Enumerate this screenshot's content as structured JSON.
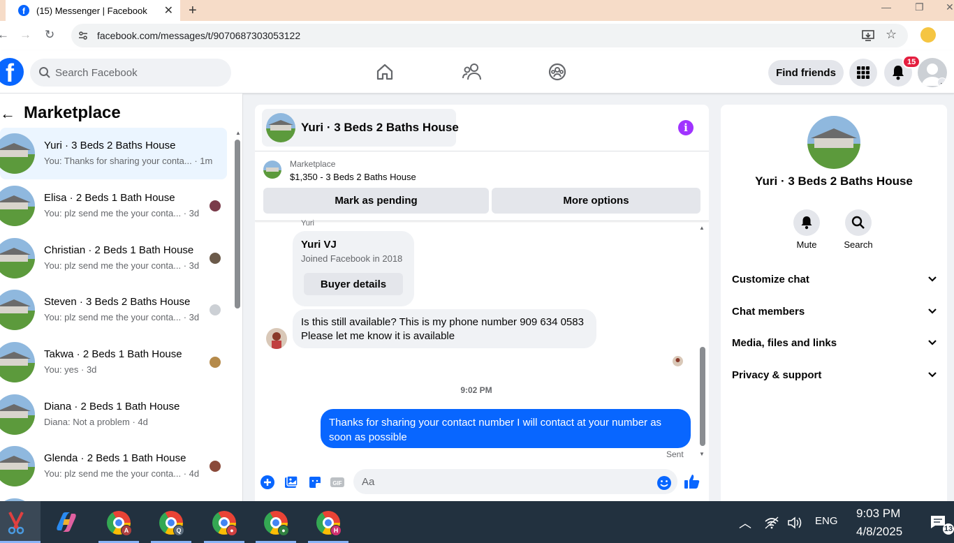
{
  "browser": {
    "tab_title": "(15) Messenger | Facebook",
    "url": "facebook.com/messages/t/9070687303053122"
  },
  "header": {
    "search_placeholder": "Search Facebook",
    "find_friends": "Find friends",
    "notification_count": "15"
  },
  "sidebar": {
    "title": "Marketplace",
    "conversations": [
      {
        "title": "Yuri · 3 Beds 2 Baths House",
        "preview": "You: Thanks for sharing your conta... · 1m",
        "active": true
      },
      {
        "title": "Elisa · 2 Beds 1 Bath House",
        "preview": "You: plz send me the your conta... · 3d"
      },
      {
        "title": "Christian · 2 Beds 1 Bath House",
        "preview": "You: plz send me the your conta... · 3d"
      },
      {
        "title": "Steven · 3 Beds 2 Baths House",
        "preview": "You: plz send me the your conta... · 3d"
      },
      {
        "title": "Takwa · 2 Beds 1 Bath House",
        "preview": "You: yes · 3d"
      },
      {
        "title": "Diana · 2 Beds 1 Bath House",
        "preview": "Diana: Not a problem · 4d"
      },
      {
        "title": "Glenda · 2 Beds 1 Bath House",
        "preview": "You: plz send me the your conta... · 4d"
      }
    ]
  },
  "chat": {
    "title": "Yuri · 3 Beds 2 Baths House",
    "listing_label": "Marketplace",
    "listing_price": "$1,350 - 3 Beds 2 Baths House",
    "mark_pending": "Mark as pending",
    "more_options": "More options",
    "sender_label": "Yuri",
    "buyer_name": "Yuri VJ",
    "buyer_joined": "Joined Facebook in 2018",
    "buyer_details": "Buyer details",
    "incoming_line1": "Is this still available? This is my phone number 909 634 0583",
    "incoming_line2": "Please let me know it is available",
    "timestamp": "9:02 PM",
    "outgoing": "Thanks for sharing your contact number I will contact at your number as soon as possible",
    "sent_label": "Sent",
    "composer_placeholder": "Aa"
  },
  "details": {
    "name": "Yuri · 3 Beds 2 Baths House",
    "mute": "Mute",
    "search": "Search",
    "sections": [
      "Customize chat",
      "Chat members",
      "Media, files and links",
      "Privacy & support"
    ]
  },
  "taskbar": {
    "language": "ENG",
    "time": "9:03 PM",
    "date": "4/8/2025",
    "notification_count": "13",
    "chrome_profiles": [
      "A",
      "Q",
      "",
      "",
      "H"
    ]
  },
  "colors": {
    "fb_blue": "#0866ff",
    "active_bg": "#ebf5ff",
    "badge_red": "#e41e3f",
    "info_purple": "#a033ff"
  }
}
